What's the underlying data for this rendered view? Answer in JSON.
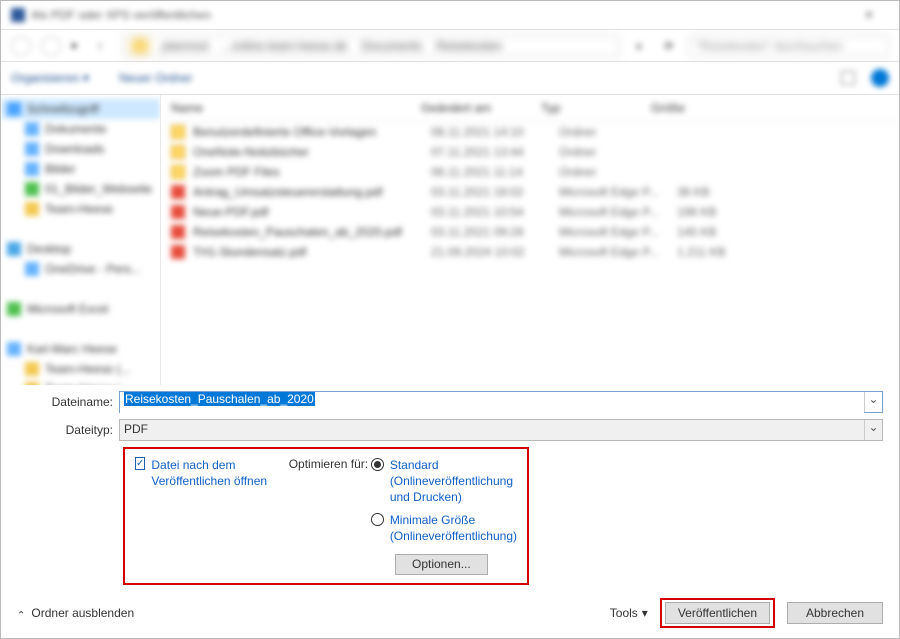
{
  "titlebar": {
    "title": "Als PDF oder XPS veröffentlichen"
  },
  "navbar": {
    "crumbs": [
      "planmod",
      "...online.team-heese.de",
      "Documents",
      "Reisekosten"
    ],
    "search_placeholder": "\"Reisekosten\" durchsuchen"
  },
  "cmdbar": {
    "organize": "Organisieren ▾",
    "new_folder": "Neuer Ordner"
  },
  "sidebar": {
    "items": [
      {
        "label": "Schnellzugriff",
        "cls": "star",
        "sel": true
      },
      {
        "label": "Dokumente",
        "cls": "blue",
        "indent": 1
      },
      {
        "label": "Downloads",
        "cls": "blue",
        "indent": 1
      },
      {
        "label": "Bilder",
        "cls": "blue",
        "indent": 1
      },
      {
        "label": "01_Bilder_Webseite",
        "cls": "grn",
        "indent": 1
      },
      {
        "label": "Team-Heese",
        "cls": "yl",
        "indent": 1
      },
      {
        "label": "",
        "cls": "",
        "indent": 0
      },
      {
        "label": "Desktop",
        "cls": "desk",
        "indent": 0
      },
      {
        "label": "OneDrive - Pers...",
        "cls": "blue",
        "indent": 1
      },
      {
        "label": "",
        "cls": "",
        "indent": 0
      },
      {
        "label": "Microsoft Excel",
        "cls": "grn",
        "indent": 0
      },
      {
        "label": "",
        "cls": "",
        "indent": 0
      },
      {
        "label": "Karl-Marc Heese",
        "cls": "blue",
        "indent": 0
      },
      {
        "label": "Team-Heese (...",
        "cls": "yl",
        "indent": 1
      },
      {
        "label": "Team-Heese (...",
        "cls": "yl",
        "indent": 1
      }
    ]
  },
  "columns": {
    "name": "Name",
    "modified": "Geändert am",
    "type": "Typ",
    "size": "Größe"
  },
  "files": [
    {
      "icon": "fold",
      "name": "Benutzerdefinierte Office-Vorlagen",
      "m": "08.11.2021 14:10",
      "t": "Ordner",
      "s": ""
    },
    {
      "icon": "fold",
      "name": "OneNote-Notizbücher",
      "m": "07.11.2021 13:44",
      "t": "Ordner",
      "s": ""
    },
    {
      "icon": "fold",
      "name": "Zoom PDF Files",
      "m": "06.11.2021 11:14",
      "t": "Ordner",
      "s": ""
    },
    {
      "icon": "pdf",
      "name": "Antrag_Umsatzsteuererstattung.pdf",
      "m": "03.11.2021 18:02",
      "t": "Microsoft Edge P...",
      "s": "38 KB"
    },
    {
      "icon": "pdf",
      "name": "Neue-PDF.pdf",
      "m": "03.11.2021 10:54",
      "t": "Microsoft Edge P...",
      "s": "198 KB"
    },
    {
      "icon": "pdf",
      "name": "Reisekosten_Pauschalen_ab_2020.pdf",
      "m": "03.11.2021 09:28",
      "t": "Microsoft Edge P...",
      "s": "145 KB"
    },
    {
      "icon": "pdf",
      "name": "TH1-Stundensatz.pdf",
      "m": "21.09.2024 10:02",
      "t": "Microsoft Edge P...",
      "s": "1.211 KB"
    }
  ],
  "form": {
    "filename_label": "Dateiname:",
    "filename_value": "Reisekosten_Pauschalen_ab_2020",
    "filetype_label": "Dateityp:",
    "filetype_value": "PDF"
  },
  "options": {
    "open_after_label": "Datei nach dem Veröffentlichen öffnen",
    "optimize_label": "Optimieren für:",
    "standard_label": "Standard (Onlineveröffentlichung und Drucken)",
    "min_label": "Minimale Größe (Onlineveröffentlichung)",
    "options_btn": "Optionen..."
  },
  "footer": {
    "hide_folders": "Ordner ausblenden",
    "tools": "Tools",
    "publish": "Veröffentlichen",
    "cancel": "Abbrechen"
  }
}
